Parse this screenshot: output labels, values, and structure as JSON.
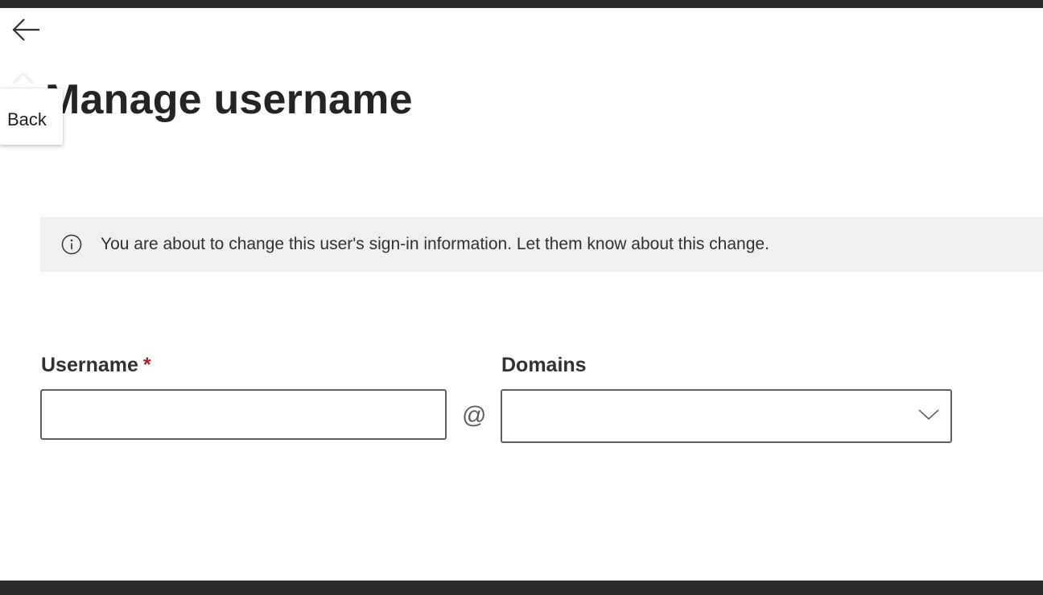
{
  "header": {
    "back_tooltip": "Back",
    "title": "Manage username"
  },
  "info_bar": {
    "icon": "info-icon",
    "message": "You are about to change this user's sign-in information. Let them know about this change."
  },
  "form": {
    "username": {
      "label": "Username",
      "required_mark": "*",
      "value": "",
      "placeholder": ""
    },
    "separator": "@",
    "domains": {
      "label": "Domains",
      "selected": "",
      "icon": "chevron-down-icon"
    }
  },
  "colors": {
    "required": "#a4262c",
    "info_background": "#f0f0f0",
    "border": "#605e5c",
    "title": "#242424"
  }
}
